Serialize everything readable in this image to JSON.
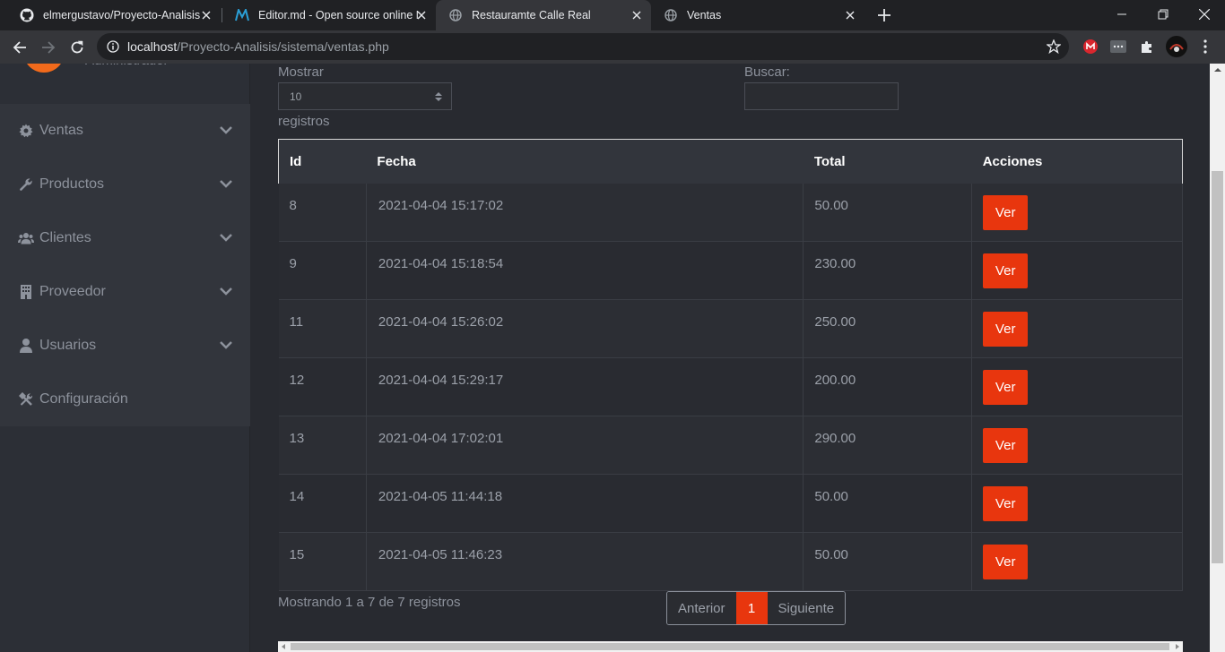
{
  "browser": {
    "tabs": [
      {
        "title": "elmergustavo/Proyecto-Analisis",
        "icon": "github-icon"
      },
      {
        "title": "Editor.md - Open source online M",
        "icon": "markdown-editor-icon"
      },
      {
        "title": "Restauramte Calle Real",
        "icon": "globe-icon",
        "active": true
      },
      {
        "title": "Ventas",
        "icon": "globe-icon"
      }
    ],
    "url_host": "localhost",
    "url_path": "/Proyecto-Analisis/sistema/ventas.php"
  },
  "sidebar": {
    "role": "Administrador",
    "items": [
      {
        "label": "Ventas",
        "icon": "gear-icon",
        "has_submenu": true
      },
      {
        "label": "Productos",
        "icon": "wrench-icon",
        "has_submenu": true
      },
      {
        "label": "Clientes",
        "icon": "users-icon",
        "has_submenu": true
      },
      {
        "label": "Proveedor",
        "icon": "building-icon",
        "has_submenu": true
      },
      {
        "label": "Usuarios",
        "icon": "user-icon",
        "has_submenu": true
      },
      {
        "label": "Configuración",
        "icon": "tools-icon",
        "has_submenu": false
      }
    ]
  },
  "datatable": {
    "length_label": "Mostrar",
    "length_value": "10",
    "length_suffix": "registros",
    "search_label": "Buscar:",
    "search_value": "",
    "columns": [
      "Id",
      "Fecha",
      "Total",
      "Acciones"
    ],
    "rows": [
      {
        "id": "8",
        "fecha": "2021-04-04 15:17:02",
        "total": "50.00",
        "action": "Ver"
      },
      {
        "id": "9",
        "fecha": "2021-04-04 15:18:54",
        "total": "230.00",
        "action": "Ver"
      },
      {
        "id": "11",
        "fecha": "2021-04-04 15:26:02",
        "total": "250.00",
        "action": "Ver"
      },
      {
        "id": "12",
        "fecha": "2021-04-04 15:29:17",
        "total": "200.00",
        "action": "Ver"
      },
      {
        "id": "13",
        "fecha": "2021-04-04 17:02:01",
        "total": "290.00",
        "action": "Ver"
      },
      {
        "id": "14",
        "fecha": "2021-04-05 11:44:18",
        "total": "50.00",
        "action": "Ver"
      },
      {
        "id": "15",
        "fecha": "2021-04-05 11:46:23",
        "total": "50.00",
        "action": "Ver"
      }
    ],
    "info": "Mostrando 1 a 7 de 7 registros",
    "pagination": {
      "prev": "Anterior",
      "current": "1",
      "next": "Siguiente"
    }
  },
  "colors": {
    "accent": "#e8360e",
    "sidebar_bg": "#2c2f36",
    "page_bg": "#282a30"
  }
}
